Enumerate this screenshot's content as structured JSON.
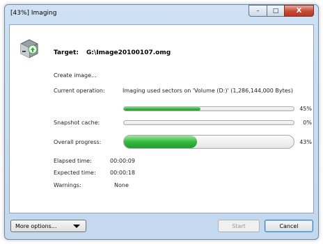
{
  "window": {
    "title": "[43%] Imaging",
    "controls": {
      "minimize": "–",
      "maximize": "□",
      "close": "X"
    }
  },
  "target": {
    "label": "Target:",
    "value": "G:\\Image20100107.omg"
  },
  "status_line": "Create image...",
  "operation": {
    "label": "Current operation:",
    "value": "Imaging used sectors on 'Volume (D:)' (1,286,144,000 Bytes)"
  },
  "progress": {
    "current": {
      "percent": 45,
      "text": "45%"
    },
    "snapshot_cache": {
      "label": "Snapshot cache:",
      "percent": 0,
      "text": "0%"
    },
    "overall": {
      "label": "Overall progress:",
      "percent": 43,
      "text": "43%"
    }
  },
  "stats": {
    "elapsed": {
      "label": "Elapsed time:",
      "value": "00:00:09"
    },
    "expected": {
      "label": "Expected time:",
      "value": "00:00:18"
    },
    "warnings": {
      "label": "Warnings:",
      "value": "None"
    }
  },
  "buttons": {
    "more_options": "More options...",
    "start": "Start",
    "cancel": "Cancel"
  },
  "colors": {
    "progress_fill": "#2fb53a",
    "frame": "#c4d8ee",
    "close": "#c64832"
  },
  "icons": {
    "app": "disk-image-icon"
  }
}
